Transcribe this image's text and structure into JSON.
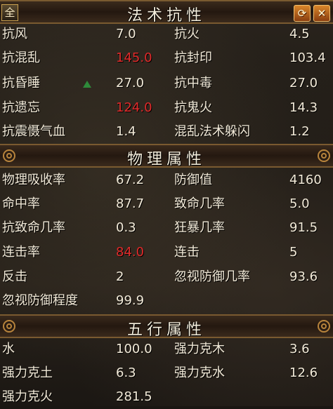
{
  "toolbar": {
    "all_label": "全",
    "refresh_icon": "refresh-icon",
    "close_icon": "close-icon",
    "refresh_glyph": "⟳",
    "close_glyph": "✕"
  },
  "sections": {
    "magic": {
      "title": "法术抗性",
      "rows": [
        [
          "抗风",
          "7.0",
          "抗火",
          "4.5"
        ],
        [
          "抗混乱",
          "145.0",
          "抗封印",
          "103.4"
        ],
        [
          "抗昏睡",
          "27.0",
          "抗中毒",
          "27.0"
        ],
        [
          "抗遗忘",
          "124.0",
          "抗鬼火",
          "14.3"
        ],
        [
          "抗震慑气血",
          "1.4",
          "混乱法术躲闪",
          "1.2"
        ]
      ]
    },
    "physical": {
      "title": "物理属性",
      "rows": [
        [
          "物理吸收率",
          "67.2",
          "防御值",
          "4160"
        ],
        [
          "命中率",
          "87.7",
          "致命几率",
          "5.0"
        ],
        [
          "抗致命几率",
          "0.3",
          "狂暴几率",
          "91.5"
        ],
        [
          "连击率",
          "84.0",
          "连击",
          "5"
        ],
        [
          "反击",
          "2",
          "忽视防御几率",
          "93.6"
        ],
        [
          "忽视防御程度",
          "99.9",
          "",
          ""
        ]
      ]
    },
    "elements": {
      "title": "五行属性",
      "rows": [
        [
          "水",
          "100.0",
          "强力克木",
          "3.6"
        ],
        [
          "强力克土",
          "6.3",
          "强力克水",
          "12.6"
        ],
        [
          "强力克火",
          "281.5",
          "",
          ""
        ]
      ]
    }
  },
  "colors": {
    "highlight_red": "#e02a2a",
    "text": "#f2ead8",
    "border_gold": "#b8843c"
  }
}
